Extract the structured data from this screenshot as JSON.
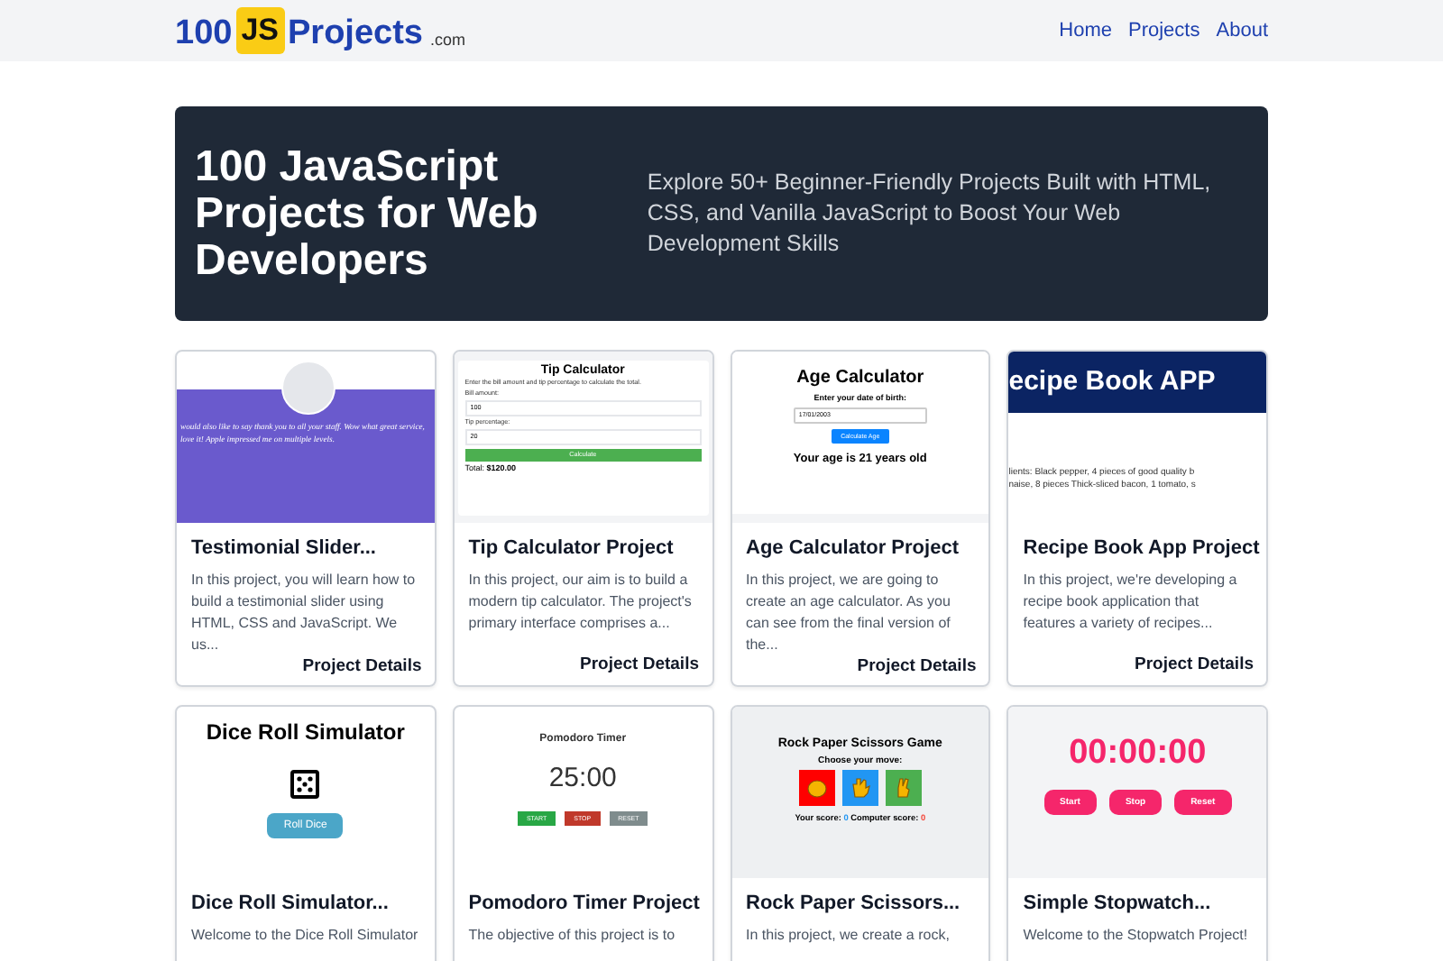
{
  "header": {
    "logo": {
      "number": "100",
      "badge": "JS",
      "name": "Projects",
      "suffix": ".com"
    },
    "nav": [
      {
        "label": "Home"
      },
      {
        "label": "Projects"
      },
      {
        "label": "About"
      }
    ]
  },
  "hero": {
    "title": "100 JavaScript Projects for Web Developers",
    "subtitle": "Explore 50+ Beginner-Friendly Projects Built with HTML, CSS, and Vanilla JavaScript to Boost Your Web Development Skills"
  },
  "projects": [
    {
      "title": "Testimonial Slider...",
      "description": "In this project, you will learn how to build a testimonial slider using HTML, CSS and JavaScript. We us...",
      "link": "Project Details",
      "preview": {
        "kind": "testimonial",
        "texts": [
          "would also like to say thank you to all your staff. Wow what great service,",
          "love it! Apple impressed me on multiple levels."
        ]
      }
    },
    {
      "title": "Tip Calculator Project",
      "description": "In this project, our aim is to build a modern tip calculator. The project's primary interface comprises a...",
      "link": "Project Details",
      "preview": {
        "kind": "tip",
        "texts": [
          "Tip Calculator",
          "Enter the bill amount and tip percentage to calculate the total.",
          "Bill amount:",
          "100",
          "Tip percentage:",
          "20",
          "Calculate",
          "Total:",
          "$120.00"
        ]
      }
    },
    {
      "title": "Age Calculator Project",
      "description": "In this project, we are going to create an age calculator. As you can see from the final version of the...",
      "link": "Project Details",
      "preview": {
        "kind": "age",
        "texts": [
          "Age Calculator",
          "Enter your date of birth:",
          "17/01/2003",
          "Calculate Age",
          "Your age is 21 years old"
        ]
      }
    },
    {
      "title": "Recipe Book App Project",
      "description": "In this project, we're developing a recipe book application that features a variety of recipes...",
      "link": "Project Details",
      "preview": {
        "kind": "recipe",
        "texts": [
          "ecipe Book APP",
          "lients: Black pepper, 4 pieces of good quality b",
          "naise, 8 pieces Thick-sliced bacon, 1 tomato, s"
        ]
      }
    },
    {
      "title": "Dice Roll Simulator...",
      "description": "Welcome to the Dice Roll Simulator",
      "preview": {
        "kind": "dice",
        "texts": [
          "Dice Roll Simulator",
          "Roll Dice"
        ]
      }
    },
    {
      "title": "Pomodoro Timer Project",
      "description": "The objective of this project is to",
      "preview": {
        "kind": "pomodoro",
        "texts": [
          "Pomodoro Timer",
          "25:00",
          "START",
          "STOP",
          "RESET"
        ]
      }
    },
    {
      "title": "Rock Paper Scissors...",
      "description": "In this project, we create a rock,",
      "preview": {
        "kind": "rps",
        "texts": [
          "Rock Paper Scissors Game",
          "Choose your move:",
          "Your score:",
          "0",
          "Computer score:",
          "0"
        ]
      }
    },
    {
      "title": "Simple Stopwatch...",
      "description": "Welcome to the Stopwatch Project!",
      "preview": {
        "kind": "stopwatch",
        "texts": [
          "00:00:00",
          "Start",
          "Stop",
          "Reset"
        ]
      }
    }
  ]
}
